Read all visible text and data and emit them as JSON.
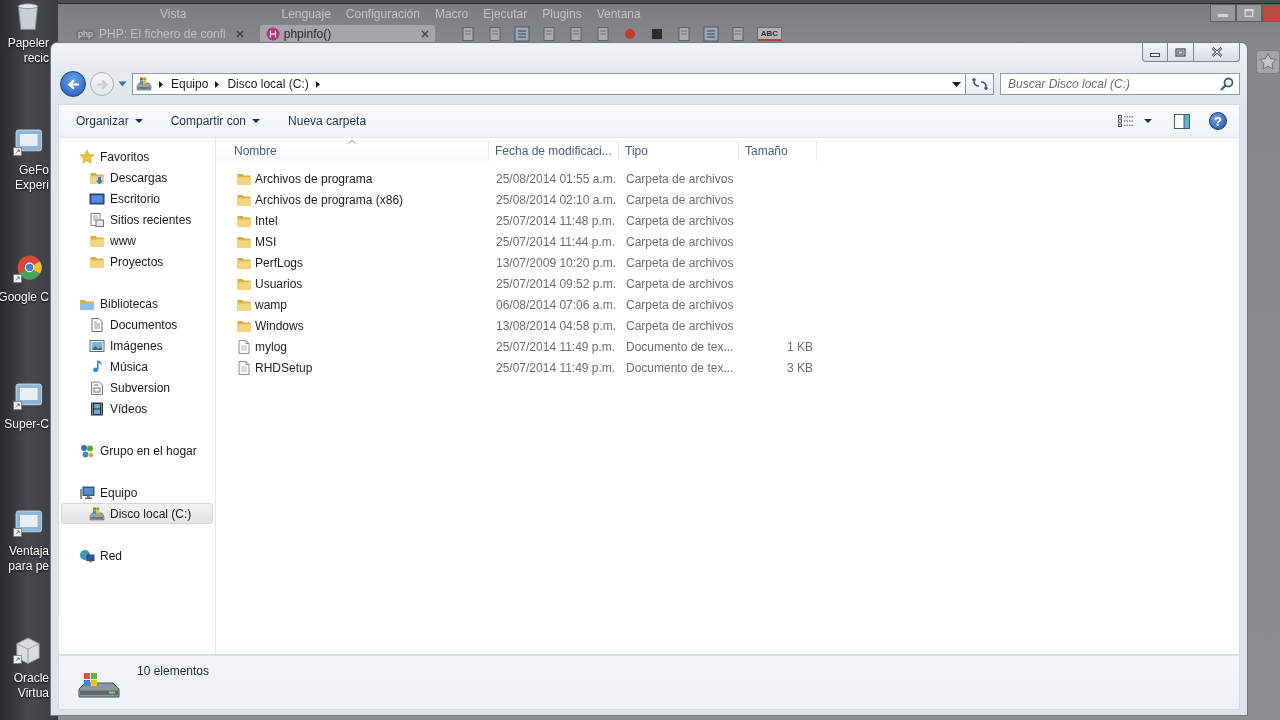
{
  "desktop": {
    "icons": [
      {
        "kind": "trash",
        "lines": [
          "Papeler",
          "recic"
        ]
      },
      {
        "kind": "app",
        "lines": [
          "GeFo",
          "Experi"
        ]
      },
      {
        "kind": "round",
        "lines": [
          "Google C"
        ]
      },
      {
        "kind": "app",
        "lines": [
          "Super-C"
        ]
      },
      {
        "kind": "app",
        "lines": [
          "Ventaja",
          "para pe"
        ]
      },
      {
        "kind": "box",
        "lines": [
          "Oracle",
          "Virtua"
        ]
      }
    ]
  },
  "background_window": {
    "menu": [
      "Vista",
      "Lenguaje",
      "Configuración",
      "Macro",
      "Ejecutar",
      "Plugins",
      "Ventana"
    ],
    "tabs": [
      {
        "logo": "php",
        "label": "PHP: El fichero de confi",
        "selected": false
      },
      {
        "label": "phpinfo()",
        "selected": true
      }
    ],
    "toolbar": [
      {
        "kind": "page"
      },
      {
        "kind": "page"
      },
      {
        "kind": "list"
      },
      {
        "kind": "page"
      },
      {
        "kind": "page"
      },
      {
        "kind": "page"
      },
      {
        "kind": "record"
      },
      {
        "kind": "stop"
      },
      {
        "kind": "page"
      },
      {
        "kind": "list"
      },
      {
        "kind": "page"
      },
      {
        "kind": "spell",
        "label": "ABC"
      }
    ]
  },
  "explorer": {
    "navigation": {
      "back": {
        "disabled": false
      },
      "forward": {
        "disabled": true
      }
    },
    "address": {
      "crumbs": [
        "Equipo",
        "Disco local (C:)"
      ]
    },
    "search": {
      "placeholder": "Buscar Disco local (C:)"
    },
    "toolbar": {
      "buttons": [
        {
          "kind": "menu",
          "label": "Organizar"
        },
        {
          "kind": "menu",
          "label": "Compartir con"
        },
        {
          "kind": "button",
          "label": "Nueva carpeta"
        }
      ],
      "help": "?"
    },
    "sidebar": {
      "groups": [
        {
          "kind": "favorites",
          "label": "Favoritos",
          "selected": false,
          "children": [
            {
              "kind": "downloads",
              "label": "Descargas",
              "selected": false
            },
            {
              "kind": "desktop",
              "label": "Escritorio",
              "selected": false
            },
            {
              "kind": "recent",
              "label": "Sitios recientes",
              "selected": false
            },
            {
              "kind": "folder",
              "label": "www",
              "selected": false
            },
            {
              "kind": "folder",
              "label": "Proyectos",
              "selected": false
            }
          ]
        },
        {
          "kind": "libraries",
          "label": "Bibliotecas",
          "selected": false,
          "children": [
            {
              "kind": "documents",
              "label": "Documentos",
              "selected": false
            },
            {
              "kind": "pictures",
              "label": "Imágenes",
              "selected": false
            },
            {
              "kind": "music",
              "label": "Música",
              "selected": false
            },
            {
              "kind": "document",
              "label": "Subversion",
              "selected": false
            },
            {
              "kind": "videos",
              "label": "Vídeos",
              "selected": false
            }
          ]
        },
        {
          "kind": "homegroup",
          "label": "Grupo en el hogar",
          "selected": false
        },
        {
          "kind": "computer",
          "label": "Equipo",
          "selected": false,
          "children": [
            {
              "kind": "drive",
              "label": "Disco local (C:)",
              "selected": true
            }
          ]
        },
        {
          "kind": "network",
          "label": "Red",
          "selected": false
        }
      ]
    },
    "table": {
      "columns": [
        {
          "label": "Nombre",
          "sorted": true
        },
        {
          "label": "Fecha de modificaci...",
          "sorted": false
        },
        {
          "label": "Tipo",
          "sorted": false
        },
        {
          "label": "Tamaño",
          "sorted": false
        }
      ],
      "rows": [
        {
          "kind": "folder",
          "name": "Archivos de programa",
          "date": "25/08/2014 01:55 a.m.",
          "type": "Carpeta de archivos",
          "selected": false
        },
        {
          "kind": "folder",
          "name": "Archivos de programa (x86)",
          "date": "25/08/2014 02:10 a.m.",
          "type": "Carpeta de archivos",
          "selected": false
        },
        {
          "kind": "folder",
          "name": "Intel",
          "date": "25/07/2014 11:48 p.m.",
          "type": "Carpeta de archivos",
          "selected": false
        },
        {
          "kind": "folder",
          "name": "MSI",
          "date": "25/07/2014 11:44 p.m.",
          "type": "Carpeta de archivos",
          "selected": false
        },
        {
          "kind": "folder",
          "name": "PerfLogs",
          "date": "13/07/2009 10:20 p.m.",
          "type": "Carpeta de archivos",
          "selected": false
        },
        {
          "kind": "folder",
          "name": "Usuarios",
          "date": "25/07/2014 09:52 p.m.",
          "type": "Carpeta de archivos",
          "selected": false
        },
        {
          "kind": "folder",
          "name": "wamp",
          "date": "06/08/2014 07:06 a.m.",
          "type": "Carpeta de archivos",
          "selected": false
        },
        {
          "kind": "folder",
          "name": "Windows",
          "date": "13/08/2014 04:58 p.m.",
          "type": "Carpeta de archivos",
          "selected": false
        },
        {
          "kind": "file",
          "name": "mylog",
          "date": "25/07/2014 11:49 p.m.",
          "type": "Documento de tex...",
          "size": "1 KB",
          "selected": false
        },
        {
          "kind": "file",
          "name": "RHDSetup",
          "date": "25/07/2014 11:49 p.m.",
          "type": "Documento de tex...",
          "size": "3 KB",
          "selected": false
        }
      ]
    },
    "status_bar": {
      "text": "10 elementos"
    }
  }
}
